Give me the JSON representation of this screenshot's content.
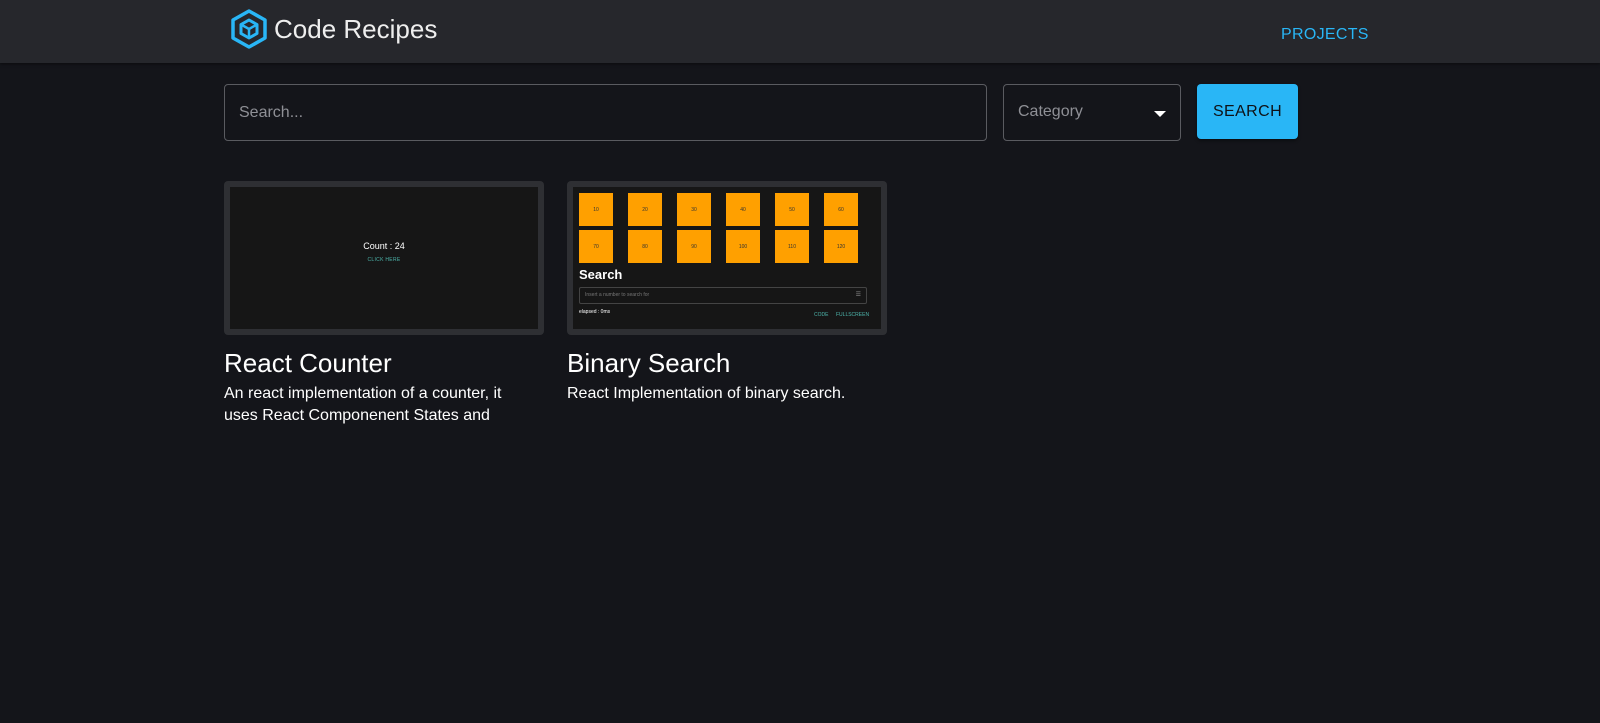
{
  "header": {
    "title": "Code Recipes",
    "logo_icon": "hexagon-cube-icon",
    "nav_projects": "PROJECTS",
    "accent_color": "#29b6f6"
  },
  "search": {
    "placeholder": "Search...",
    "value": "",
    "category_label": "Category",
    "button_label": "SEARCH"
  },
  "cards": [
    {
      "title": "React Counter",
      "description": "An react implementation of a counter, it uses React Componenent States and",
      "preview": {
        "count_text": "Count : 24",
        "link_text": "CLICK HERE"
      }
    },
    {
      "title": "Binary Search",
      "description": "React Implementation of binary search.",
      "preview": {
        "boxes": [
          "10",
          "20",
          "30",
          "40",
          "50",
          "60",
          "70",
          "80",
          "90",
          "100",
          "110",
          "120"
        ],
        "box_color": "#ffa000",
        "heading": "Search",
        "input_placeholder": "Insert a number to search for",
        "elapsed": "elapsed : 0ms",
        "code_link": "CODE",
        "fullscreen_link": "FULLSCREEN"
      }
    }
  ]
}
